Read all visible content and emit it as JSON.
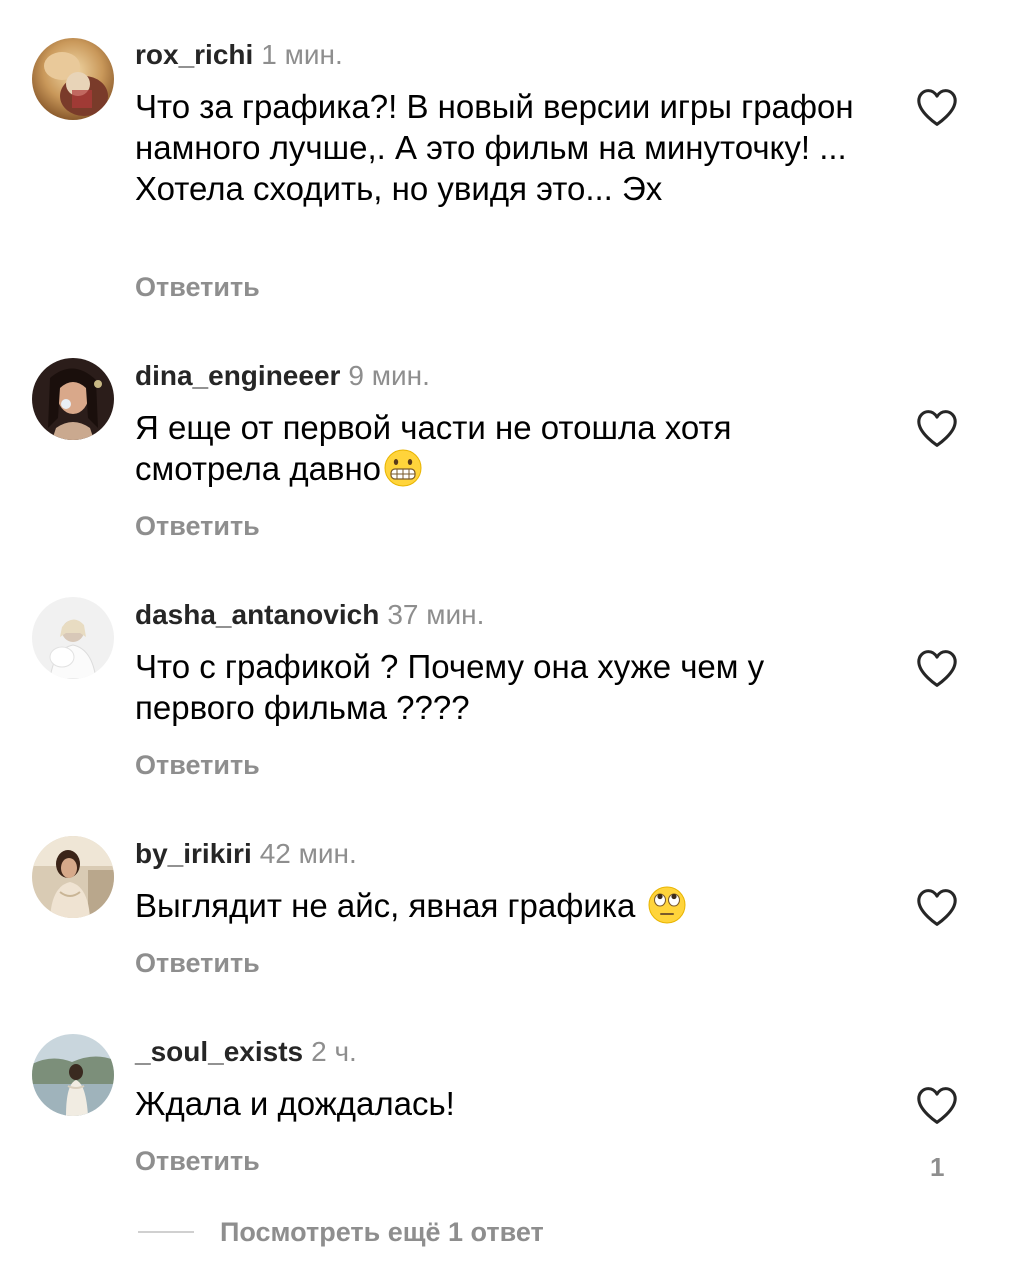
{
  "comments": [
    {
      "username": "rox_richi",
      "time": "1 мин.",
      "text": "Что за графика?! В новый версии игры графон намного лучше,. А это фильм на минуточку! ... Хотела сходить, но увидя это... Эх",
      "reply_label": "Ответить",
      "avatar": "avatar-rox-richi"
    },
    {
      "username": "dina_engineeer",
      "time": "9 мин.",
      "text": "Я еще от первой части не отошла хотя смотрела давно",
      "emoji": "grimacing-face-emoji",
      "reply_label": "Ответить",
      "avatar": "avatar-dina-engineeer"
    },
    {
      "username": "dasha_antanovich",
      "time": "37 мин.",
      "text": "Что с графикой ? Почему она хуже чем у первого фильма ????",
      "reply_label": "Ответить",
      "avatar": "avatar-dasha-antanovich"
    },
    {
      "username": "by_irikiri",
      "time": "42 мин.",
      "text": "Выглядит не айс, явная графика ",
      "emoji": "eye-roll-face-emoji",
      "reply_label": "Ответить",
      "avatar": "avatar-by-irikiri"
    },
    {
      "username": "_soul_exists",
      "time": "2 ч.",
      "text": "Ждала и дождалась!",
      "reply_label": "Ответить",
      "likes": "1",
      "avatar": "avatar-soul-exists"
    }
  ],
  "view_more_label": "Посмотреть ещё 1 ответ",
  "icons": {
    "like": "heart-outline-icon"
  },
  "colors": {
    "secondary_text": "#8e8e8e",
    "primary_text": "#000000",
    "username": "#262626",
    "background": "#ffffff"
  }
}
